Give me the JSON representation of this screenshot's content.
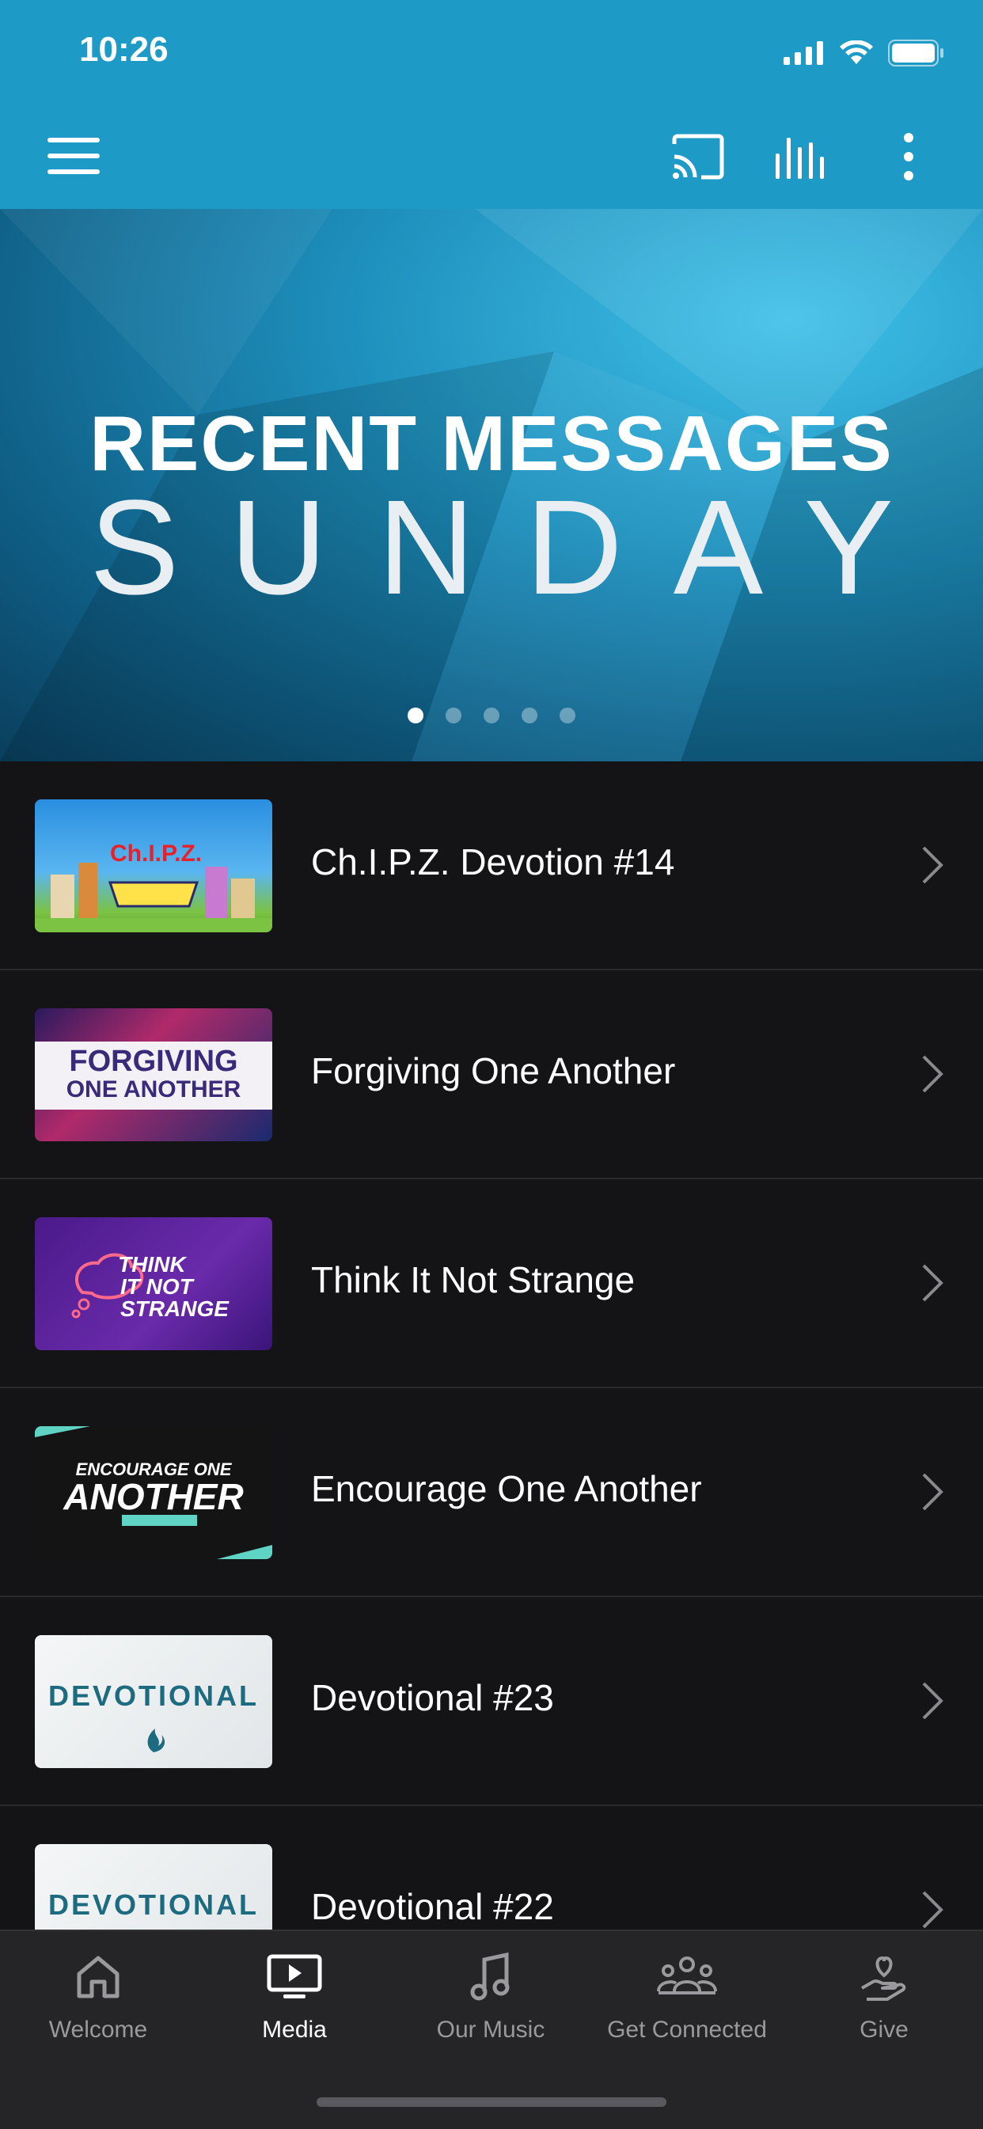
{
  "status_bar": {
    "time": "10:26"
  },
  "hero": {
    "title": "RECENT MESSAGES",
    "subtitle": "SUNDAY",
    "slides": 5,
    "active_slide": 0
  },
  "thumbnails": {
    "chipz": "Ch.I.P.Z.",
    "forgiving_line1": "FORGIVING",
    "forgiving_line2": "ONE ANOTHER",
    "think_line1": "THINK",
    "think_line2": "IT NOT",
    "think_line3": "STRANGE",
    "encourage_line1": "ENCOURAGE ONE",
    "encourage_line2": "ANOTHER",
    "devotional": "DEVOTIONAL"
  },
  "messages": [
    {
      "title": "Ch.I.P.Z. Devotion #14"
    },
    {
      "title": "Forgiving One Another"
    },
    {
      "title": "Think It Not Strange"
    },
    {
      "title": "Encourage One Another"
    },
    {
      "title": "Devotional #23"
    },
    {
      "title": "Devotional #22"
    }
  ],
  "tabs": [
    {
      "label": "Welcome",
      "icon": "home-icon",
      "active": false
    },
    {
      "label": "Media",
      "icon": "play-screen-icon",
      "active": true
    },
    {
      "label": "Our Music",
      "icon": "music-note-icon",
      "active": false
    },
    {
      "label": "Get Connected",
      "icon": "group-icon",
      "active": false
    },
    {
      "label": "Give",
      "icon": "heart-hand-icon",
      "active": false
    }
  ],
  "colors": {
    "brand": "#1e9ac6",
    "background": "#141416",
    "tabbar": "#252527"
  }
}
